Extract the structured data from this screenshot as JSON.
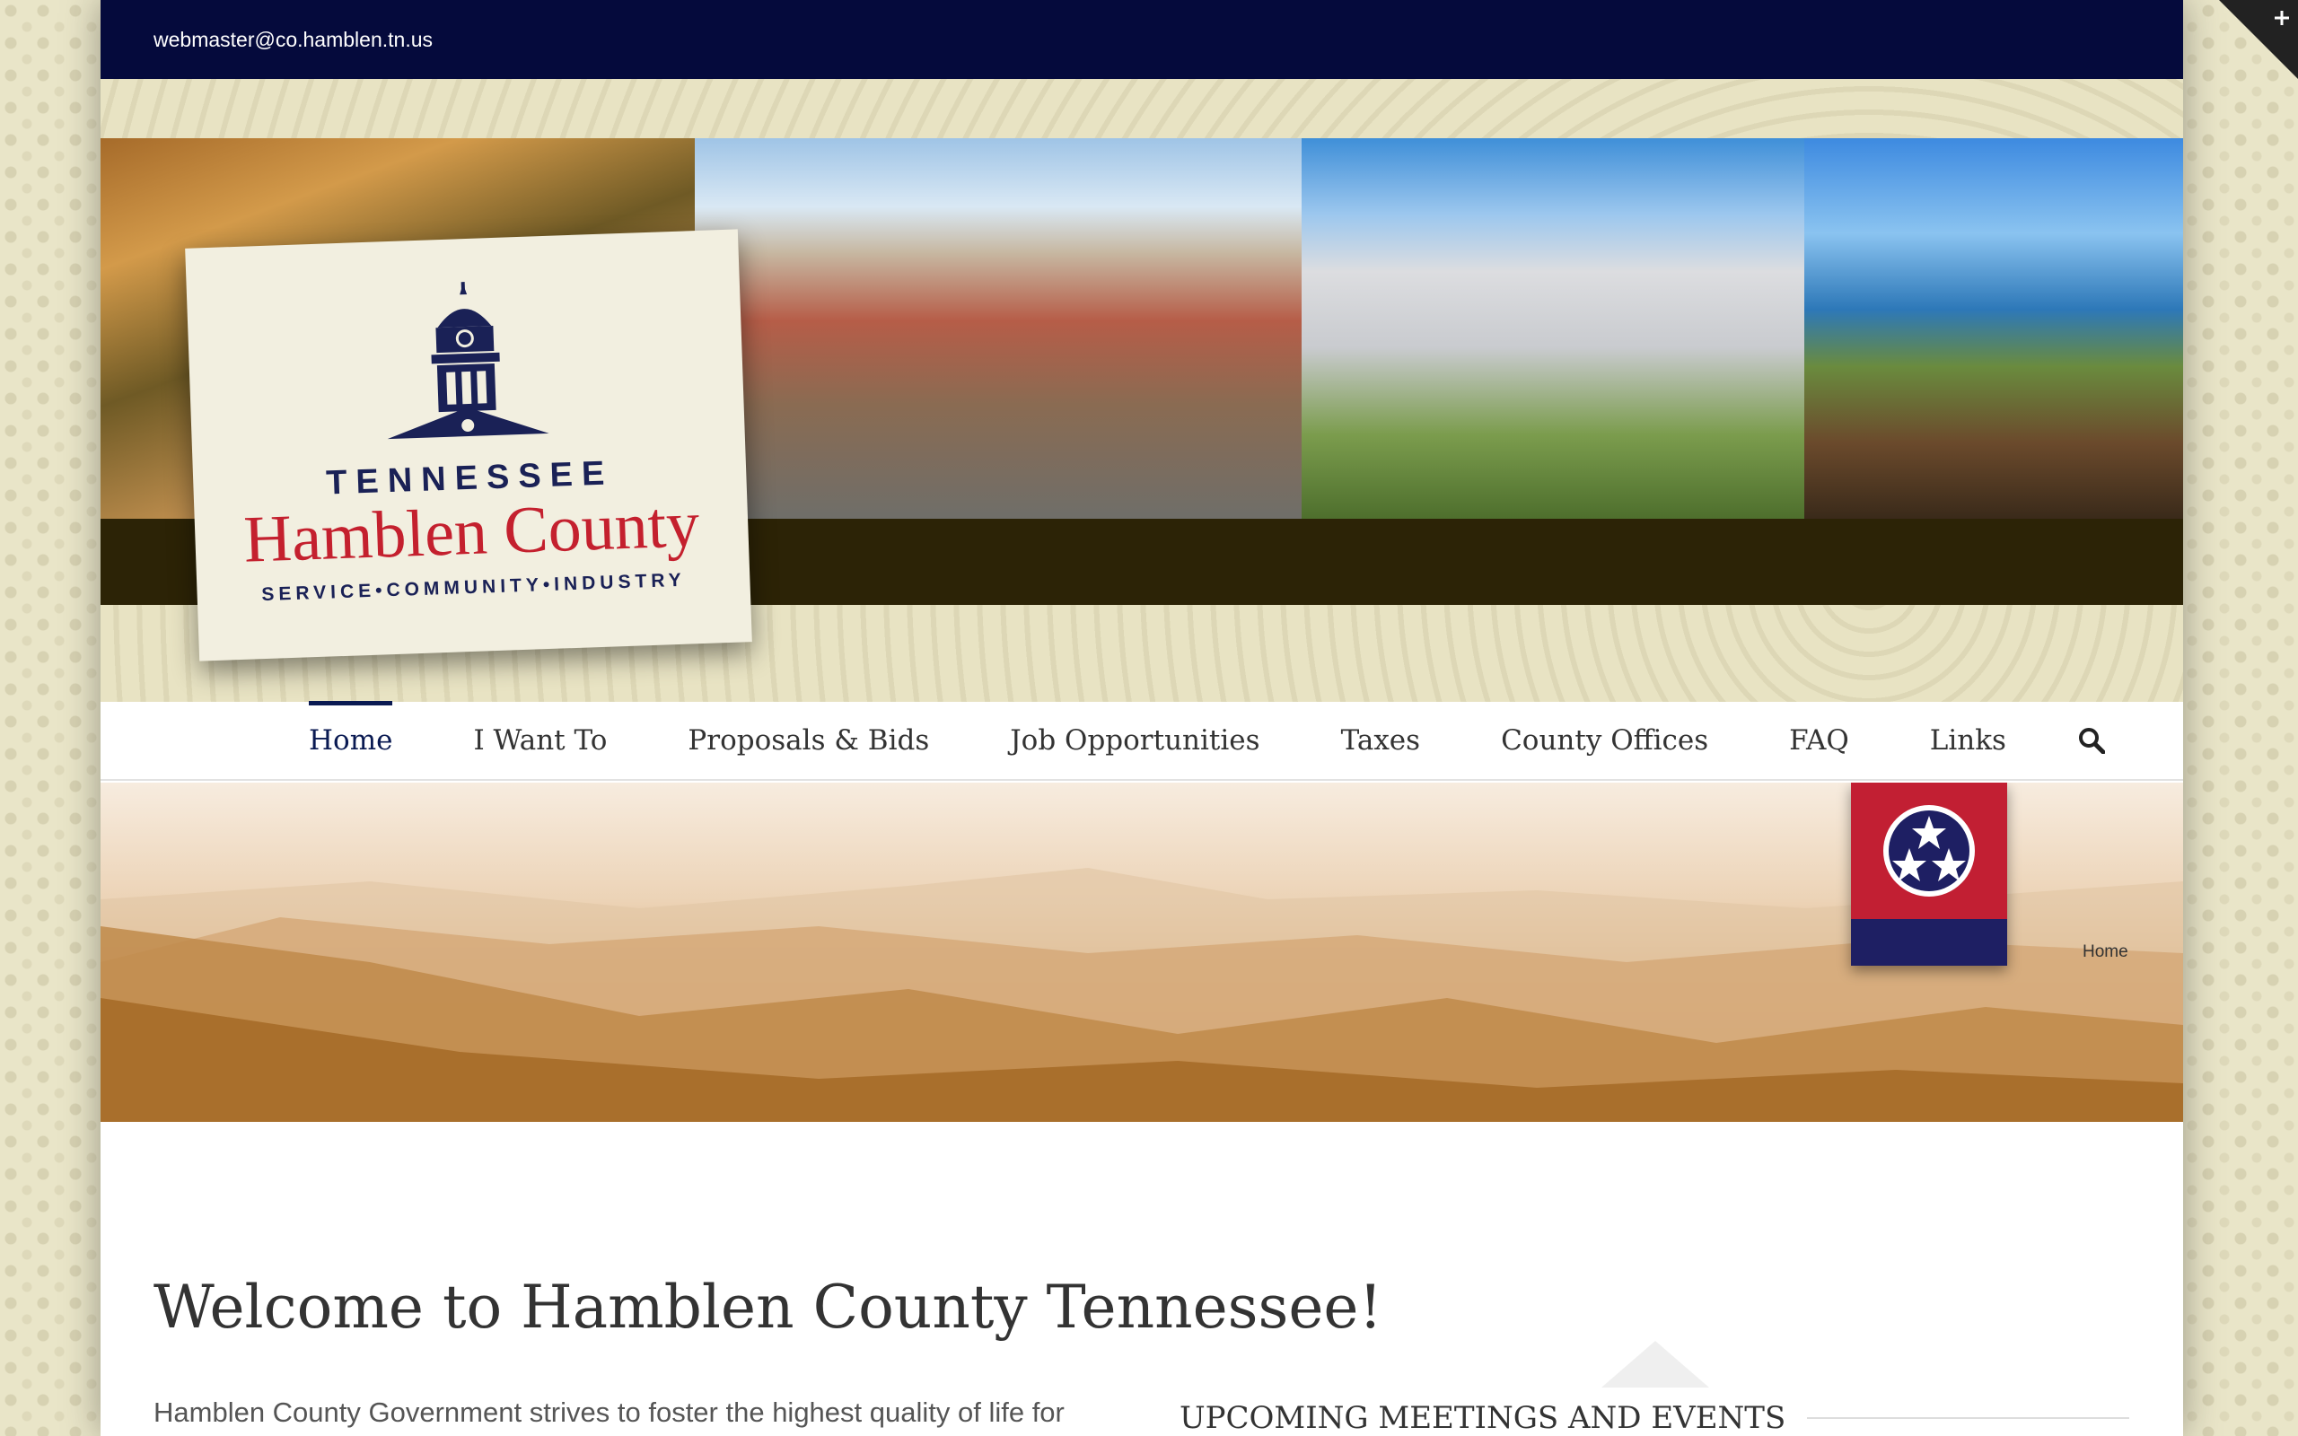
{
  "topbar": {
    "email": "webmaster@co.hamblen.tn.us"
  },
  "logo": {
    "state": "TENNESSEE",
    "county": "Hamblen County",
    "tagline": "SERVICE•COMMUNITY•INDUSTRY"
  },
  "nav": {
    "items": [
      {
        "label": "Home",
        "active": true
      },
      {
        "label": "I Want To"
      },
      {
        "label": "Proposals & Bids"
      },
      {
        "label": "Job Opportunities"
      },
      {
        "label": "Taxes"
      },
      {
        "label": "County Offices"
      },
      {
        "label": "FAQ"
      },
      {
        "label": "Links"
      }
    ],
    "search_icon": "search-icon"
  },
  "breadcrumb": {
    "label": "Home"
  },
  "main": {
    "title": "Welcome to Hamblen County Tennessee!",
    "intro": "Hamblen County Government strives to foster the highest quality of life for"
  },
  "events": {
    "title": "UPCOMING MEETINGS AND EVENTS"
  },
  "colors": {
    "topbar": "#050a3c",
    "accent_navy": "#0a1a52",
    "flag_red": "#c21f33",
    "flag_blue": "#1e1f63",
    "logo_red": "#c4202e"
  }
}
